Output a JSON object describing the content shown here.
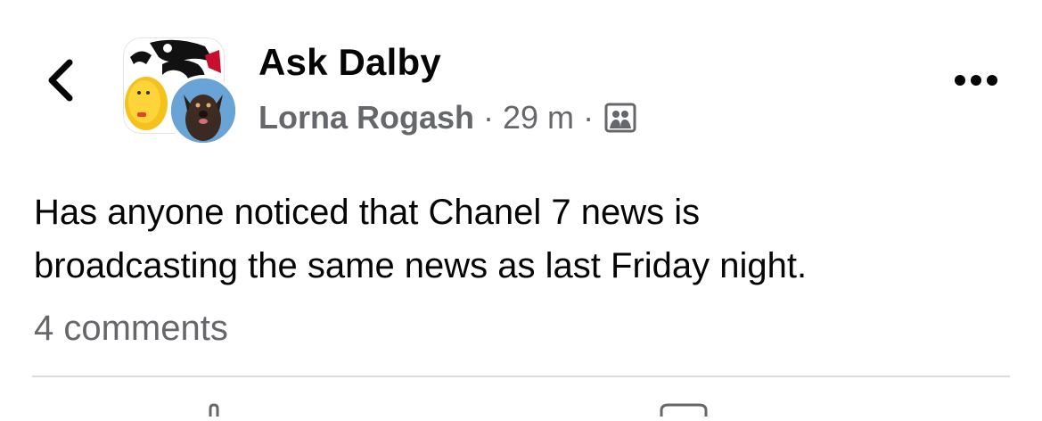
{
  "post": {
    "group_name": "Ask Dalby",
    "author_name": "Lorna Rogash",
    "separator": "·",
    "timestamp": "29 m",
    "audience_icon": "group-audience-icon",
    "body_line_1": "Has anyone noticed that Chanel 7 news is",
    "body_line_2": "broadcasting the same news as last Friday night.",
    "comments_count": "4 comments"
  },
  "icons": {
    "back": "chevron-left-icon",
    "more": "more-options-icon",
    "like": "thumbs-up-icon",
    "comment": "comment-icon"
  },
  "colors": {
    "text_primary": "#050505",
    "text_secondary": "#65676b",
    "divider": "#dcdde0",
    "background": "#ffffff"
  }
}
